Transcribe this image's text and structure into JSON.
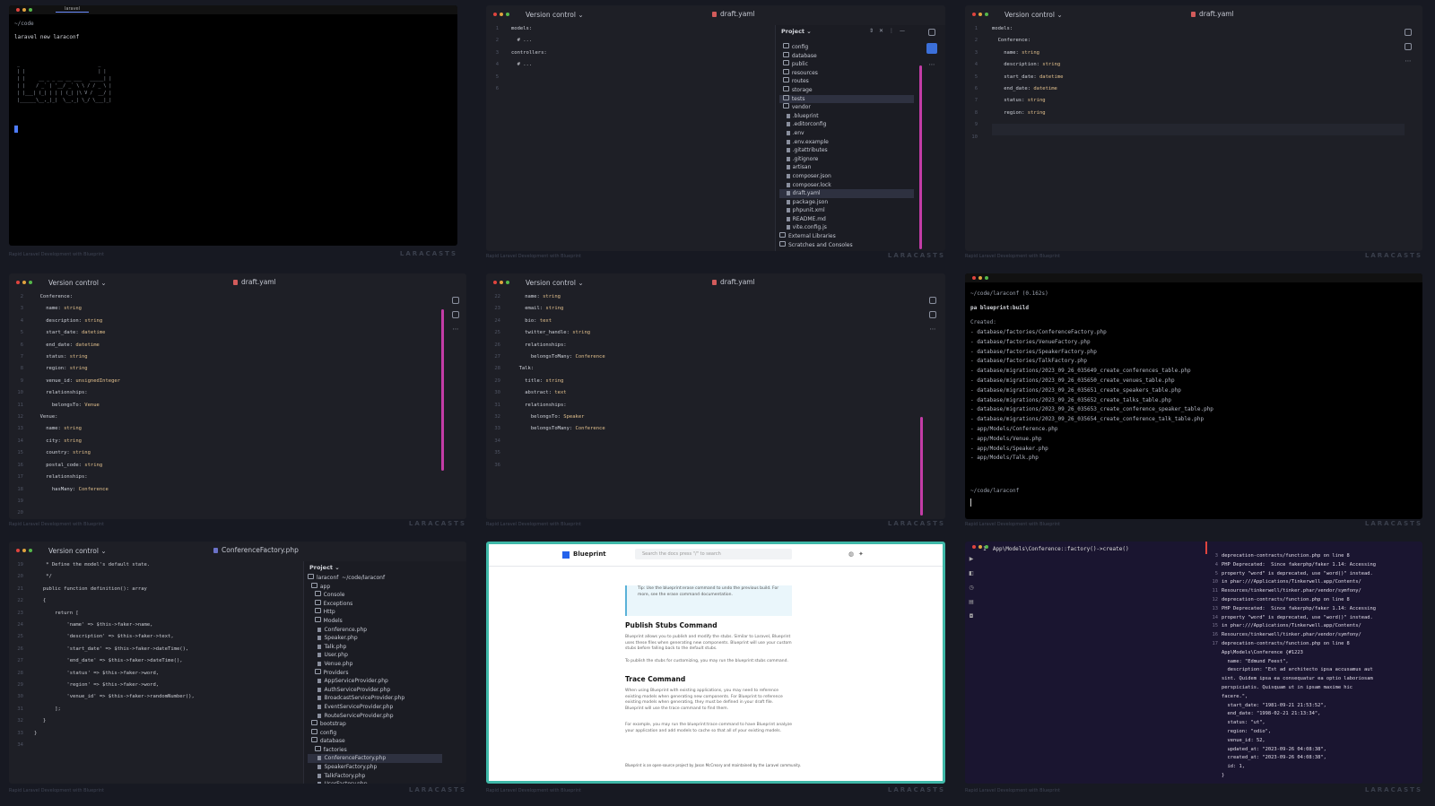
{
  "watermark": "LARACASTS",
  "caption": "Rapid Laravel Development with Blueprint",
  "colors": {
    "accent": "#c33ca6",
    "close": "#e0443e",
    "min": "#e0a33e",
    "max": "#55b84a"
  },
  "t1": {
    "tab": "laravel",
    "path": "~/code",
    "cmd": "laravel new laraconf",
    "art": [
      " _                             _",
      " | |                           | |",
      " | |     __ _ _ __ __ ___   _____| |",
      " | |    / _` | '__/ _` \\ \\ / / _ \\ |",
      " | |___| (_| | | | (_| |\\ V /  __/ |",
      " |______\\__,_|_|  \\__,_| \\_/ \\___|_|"
    ]
  },
  "t2": {
    "vc": "Version control ⌄",
    "file": "draft.yaml",
    "lines": [
      "1",
      "2",
      "3",
      "4",
      "5",
      "6"
    ],
    "code": [
      "models:",
      "  # ...",
      "",
      "controllers:",
      "  # ...",
      ""
    ],
    "project": "Project ⌄",
    "tree": [
      {
        "t": "  config",
        "k": "fold"
      },
      {
        "t": "  database",
        "k": "fold"
      },
      {
        "t": "  public",
        "k": "fold"
      },
      {
        "t": "  resources",
        "k": "fold"
      },
      {
        "t": "  routes",
        "k": "fold"
      },
      {
        "t": "  storage",
        "k": "fold"
      },
      {
        "t": "  tests",
        "k": "fold",
        "sel": true
      },
      {
        "t": "  vendor",
        "k": "fold"
      },
      {
        "t": "    .blueprint",
        "k": "fl"
      },
      {
        "t": "    .editorconfig",
        "k": "fl"
      },
      {
        "t": "    .env",
        "k": "fl"
      },
      {
        "t": "    .env.example",
        "k": "fl"
      },
      {
        "t": "    .gitattributes",
        "k": "fl"
      },
      {
        "t": "    .gitignore",
        "k": "fl"
      },
      {
        "t": "    artisan",
        "k": "fl"
      },
      {
        "t": "    composer.json",
        "k": "fl"
      },
      {
        "t": "    composer.lock",
        "k": "fl"
      },
      {
        "t": "    draft.yaml",
        "k": "fl",
        "sel": true
      },
      {
        "t": "    package.json",
        "k": "fl"
      },
      {
        "t": "    phpunit.xml",
        "k": "fl"
      },
      {
        "t": "    README.md",
        "k": "fl"
      },
      {
        "t": "    vite.config.js",
        "k": "fl"
      },
      {
        "t": "External Libraries",
        "k": "fold"
      },
      {
        "t": "Scratches and Consoles",
        "k": "fold"
      }
    ]
  },
  "t3": {
    "vc": "Version control ⌄",
    "file": "draft.yaml",
    "lines": [
      "1",
      "2",
      "3",
      "4",
      "5",
      "6",
      "7",
      "8",
      "9",
      "10"
    ],
    "code": [
      "models:",
      "  Conference:",
      "    name: string",
      "    description: string",
      "    start_date: datetime",
      "    end_date: datetime",
      "    status: string",
      "    region: string",
      "    ",
      ""
    ]
  },
  "t4": {
    "vc": "Version control ⌄",
    "file": "draft.yaml",
    "lines": [
      "2",
      "3",
      "4",
      "5",
      "6",
      "7",
      "8",
      "9",
      "10",
      "11",
      "12",
      "13",
      "14",
      "15",
      "16",
      "17",
      "18",
      "19",
      "20"
    ],
    "code": [
      "  Conference:",
      "    name: string",
      "    description: string",
      "    start_date: datetime",
      "    end_date: datetime",
      "    status: string",
      "    region: string",
      "    venue_id: unsignedInteger",
      "    relationships:",
      "      belongsTo: Venue",
      "",
      "  Venue:",
      "    name: string",
      "    city: string",
      "    country: string",
      "    postal_code: string",
      "    relationships:",
      "      hasMany: Conference",
      ""
    ]
  },
  "t5": {
    "vc": "Version control ⌄",
    "file": "draft.yaml",
    "lines": [
      "22",
      "23",
      "24",
      "25",
      "26",
      "27",
      "28",
      "29",
      "30",
      "31",
      "32",
      "33",
      "34",
      "35",
      "36"
    ],
    "code": [
      "    name: string",
      "    email: string",
      "    bio: text",
      "    twitter_handle: string",
      "    relationships:",
      "      belongsToMany: Conference",
      "",
      "  Talk:",
      "    title: string",
      "    abstract: text",
      "    relationships:",
      "      belongsTo: Speaker",
      "      belongsToMany: Conference",
      "",
      " "
    ]
  },
  "t6": {
    "path": "~/code/laraconf (0.162s)",
    "cmd": "pa blueprint:build",
    "created": "Created:",
    "files": [
      "- database/factories/ConferenceFactory.php",
      "- database/factories/VenueFactory.php",
      "- database/factories/SpeakerFactory.php",
      "- database/factories/TalkFactory.php",
      "- database/migrations/2023_09_26_035649_create_conferences_table.php",
      "- database/migrations/2023_09_26_035650_create_venues_table.php",
      "- database/migrations/2023_09_26_035651_create_speakers_table.php",
      "- database/migrations/2023_09_26_035652_create_talks_table.php",
      "- database/migrations/2023_09_26_035653_create_conference_speaker_table.php",
      "- database/migrations/2023_09_26_035654_create_conference_talk_table.php",
      "- app/Models/Conference.php",
      "- app/Models/Venue.php",
      "- app/Models/Speaker.php",
      "- app/Models/Talk.php"
    ],
    "prompt": "~/code/laraconf"
  },
  "t7": {
    "vc": "Version control ⌄",
    "file": "ConferenceFactory.php",
    "project": "Project ⌄",
    "lines": [
      "19",
      "20",
      "21",
      "22",
      "23",
      "24",
      "25",
      "26",
      "27",
      "28",
      "29",
      "30",
      "31",
      "32",
      "33",
      "34"
    ],
    "code": [
      "    * Define the model's default state.",
      "    */",
      "   public function definition(): array",
      "   {",
      "       return [",
      "           'name' => $this->faker->name,",
      "           'description' => $this->faker->text,",
      "           'start_date' => $this->faker->dateTime(),",
      "           'end_date' => $this->faker->dateTime(),",
      "           'status' => $this->faker->word,",
      "           'region' => $this->faker->word,",
      "           'venue_id' => $this->faker->randomNumber(),",
      "       ];",
      "   }",
      "}",
      ""
    ],
    "tree": [
      {
        "t": "laraconf  ~/code/laraconf",
        "k": "fold"
      },
      {
        "t": "  app",
        "k": "fold"
      },
      {
        "t": "    Console",
        "k": "fold"
      },
      {
        "t": "    Exceptions",
        "k": "fold"
      },
      {
        "t": "    Http",
        "k": "fold"
      },
      {
        "t": "    Models",
        "k": "fold"
      },
      {
        "t": "      Conference.php",
        "k": "fl"
      },
      {
        "t": "      Speaker.php",
        "k": "fl"
      },
      {
        "t": "      Talk.php",
        "k": "fl"
      },
      {
        "t": "      User.php",
        "k": "fl"
      },
      {
        "t": "      Venue.php",
        "k": "fl"
      },
      {
        "t": "    Providers",
        "k": "fold"
      },
      {
        "t": "      AppServiceProvider.php",
        "k": "fl"
      },
      {
        "t": "      AuthServiceProvider.php",
        "k": "fl"
      },
      {
        "t": "      BroadcastServiceProvider.php",
        "k": "fl"
      },
      {
        "t": "      EventServiceProvider.php",
        "k": "fl"
      },
      {
        "t": "      RouteServiceProvider.php",
        "k": "fl"
      },
      {
        "t": "  bootstrap",
        "k": "fold"
      },
      {
        "t": "  config",
        "k": "fold"
      },
      {
        "t": "  database",
        "k": "fold"
      },
      {
        "t": "    factories",
        "k": "fold"
      },
      {
        "t": "      ConferenceFactory.php",
        "k": "fl",
        "sel": true
      },
      {
        "t": "      SpeakerFactory.php",
        "k": "fl"
      },
      {
        "t": "      TalkFactory.php",
        "k": "fl"
      },
      {
        "t": "      UserFactory.php",
        "k": "fl"
      }
    ]
  },
  "t8": {
    "brand": "Blueprint",
    "search": "Search the docs  press \"/\" to search",
    "h1": "Publish Stubs Command",
    "h2": "Trace Command",
    "p1": "Blueprint allows you to publish and modify the stubs. Similar to Laravel, Blueprint uses these files when generating new components. Blueprint will use your custom stubs before falling back to the default stubs.",
    "p2": "To publish the stubs for customizing, you may run the  blueprint:stubs  command.",
    "p3": "When using Blueprint with existing applications, you may need to reference existing models when generating new components. For Blueprint to reference existing models when generating, they must be defined in your draft file. Blueprint will use the trace command to find them.",
    "p4": "For example, you may run the  blueprint:trace  command to have Blueprint analyze your application and add models to cache so that all of your existing models.",
    "note": "Tip: Use the  blueprint:erase  command to undo the previous build. For more, see the erase command documentation.",
    "foot": "Blueprint is an open-source project by Jason McCreary and maintained by the Laravel community."
  },
  "t9": {
    "cmd": "1  App\\Models\\Conference::factory()->create()",
    "right": [
      "deprecation-contracts/function.php on line 8",
      "PHP Deprecated:  Since fakerphp/faker 1.14: Accessing",
      "property \"word\" is deprecated, use \"word()\" instead.",
      "in phar:///Applications/Tinkerwell.app/Contents/",
      "Resources/tinkerwell/tinker.phar/vendor/symfony/",
      "deprecation-contracts/function.php on line 8",
      "PHP Deprecated:  Since fakerphp/faker 1.14: Accessing",
      "property \"word\" is deprecated, use \"word()\" instead.",
      "in phar:///Applications/Tinkerwell.app/Contents/",
      "Resources/tinkerwell/tinker.phar/vendor/symfony/",
      "deprecation-contracts/function.php on line 8",
      "App\\Models\\Conference {#1223",
      "  name: \"Edmund Feest\",",
      "  description: \"Est ad architecto ipsa accusamus aut",
      "sint. Quidem ipsa ea consequatur ea optio laboriosam",
      "perspiciatis. Quisquam ut in ipsam maxime hic",
      "facere.\",",
      "  start_date: \"1981-09-21 21:53:52\",",
      "  end_date: \"1998-02-21 21:13:34\",",
      "  status: \"ut\",",
      "  region: \"odio\",",
      "  venue_id: 52,",
      "  updated_at: \"2023-09-26 04:08:38\",",
      "  created_at: \"2023-09-26 04:08:38\",",
      "  id: 1,",
      "}",
      ""
    ],
    "rlines": [
      "",
      "3",
      "",
      "",
      "",
      "4",
      "",
      "",
      "",
      "",
      "5",
      "",
      "",
      "",
      "",
      "",
      "",
      "",
      "",
      "10",
      "11",
      "12",
      "13",
      "14",
      "15",
      "16",
      "17"
    ]
  }
}
